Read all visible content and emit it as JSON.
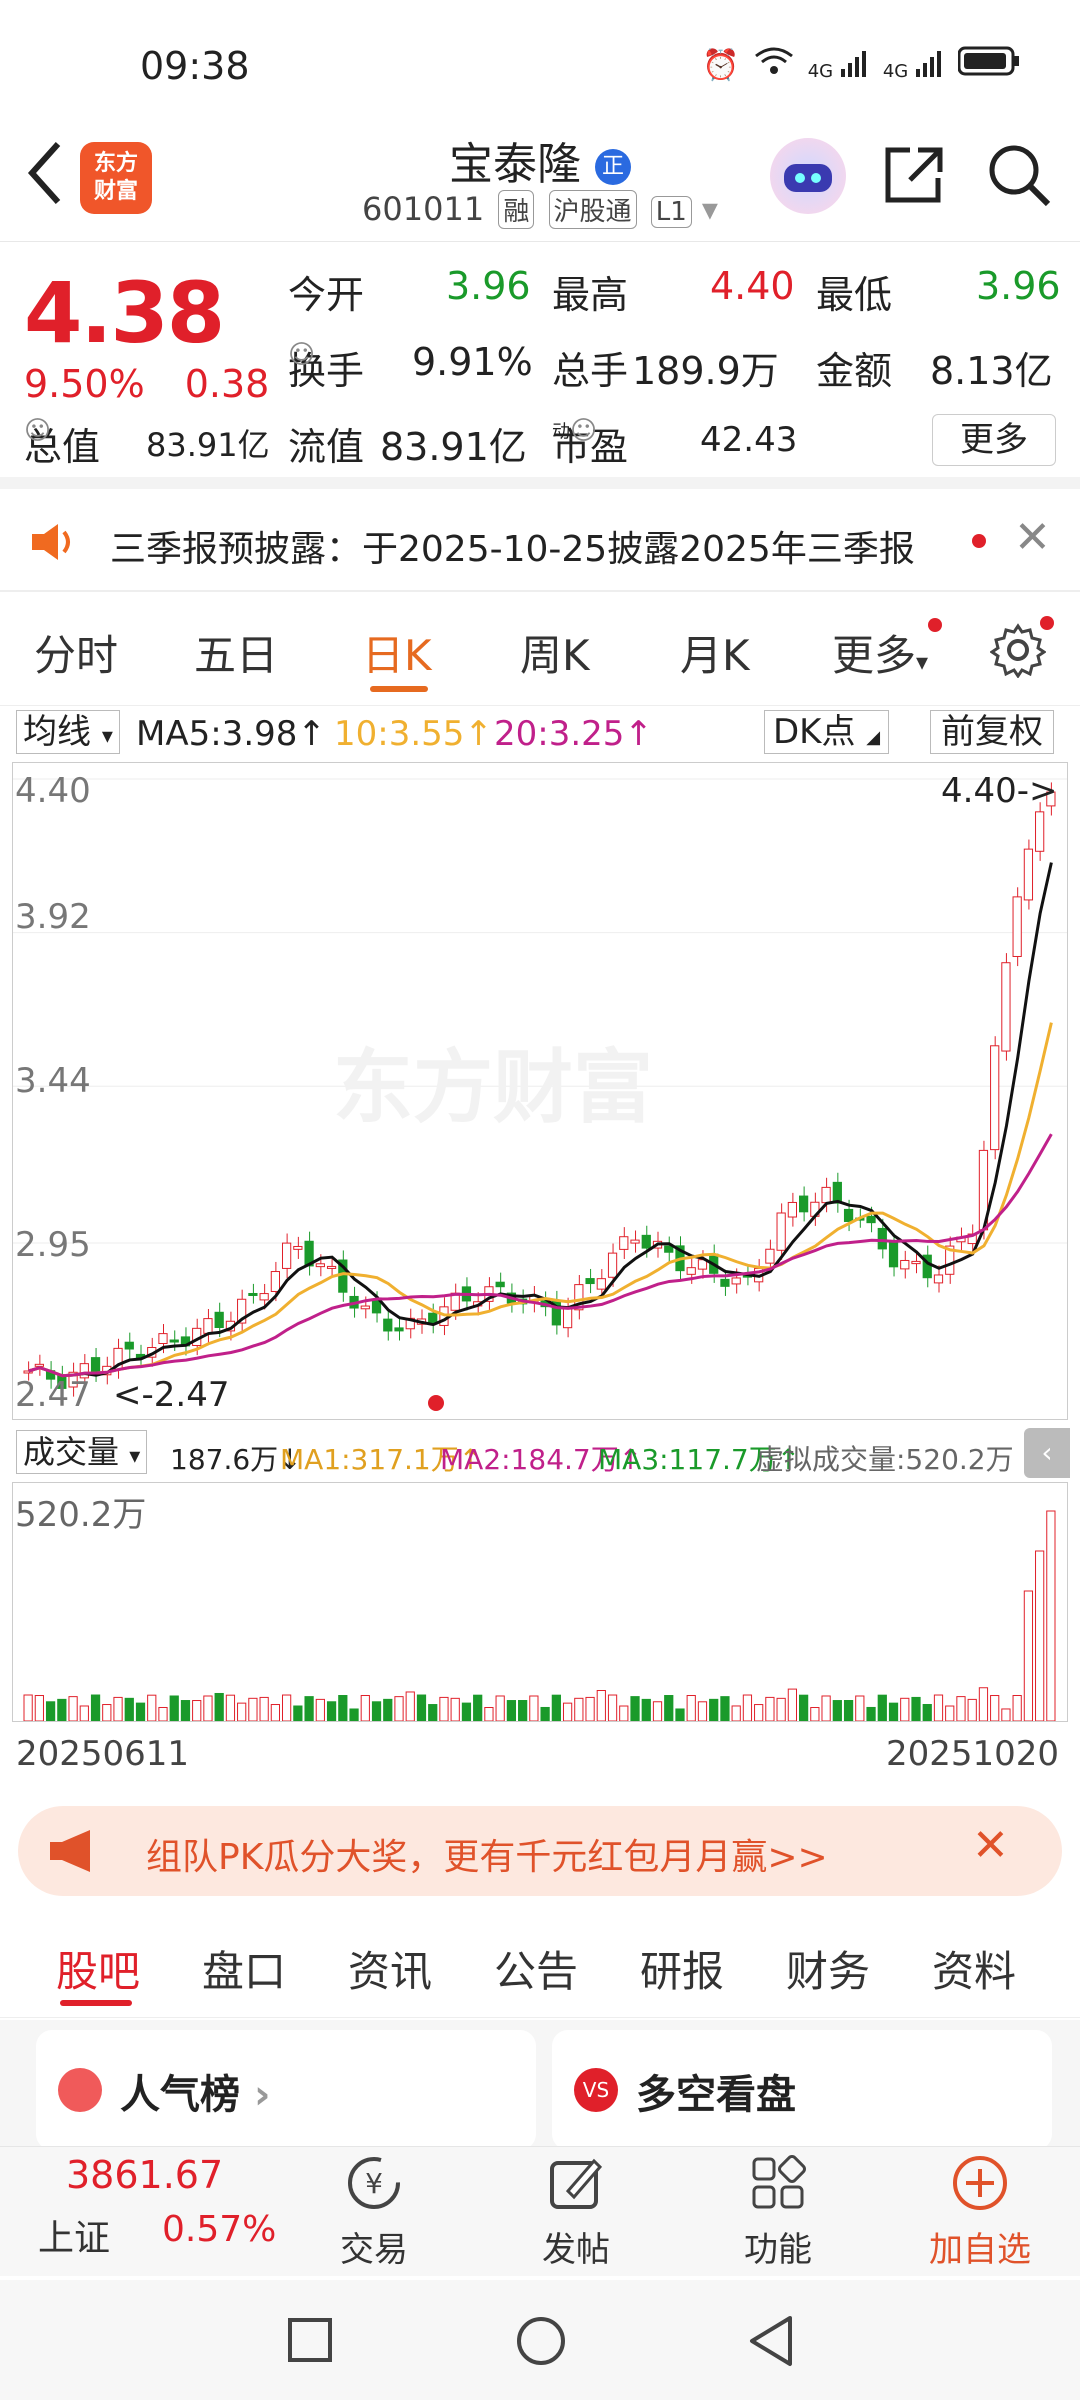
{
  "status": {
    "time": "09:38",
    "net1": "4G",
    "net2": "4G"
  },
  "header": {
    "logo_l1": "东方",
    "logo_l2": "财富",
    "title": "宝泰隆",
    "title_badge": "正",
    "code": "601011",
    "tag1": "融",
    "tag2": "沪股通",
    "tag3": "L1"
  },
  "quote": {
    "price": "4.38",
    "pct": "9.50%",
    "chg": "0.38",
    "open_label": "今开",
    "open": "3.96",
    "high_label": "最高",
    "high": "4.40",
    "low_label": "最低",
    "low": "3.96",
    "turnover_label": "换手",
    "turnover": "9.91%",
    "vol_label": "总手",
    "vol": "189.9万",
    "amount_label": "金额",
    "amount": "8.13亿",
    "mcap_label": "总值",
    "mcap": "83.91亿",
    "float_label": "流值",
    "float": "83.91亿",
    "pe_label": "市盈",
    "pe_sup": "动",
    "pe": "42.43",
    "more": "更多"
  },
  "notice": {
    "text": "三季报预披露：于2025-10-25披露2025年三季报"
  },
  "tabs": [
    "分时",
    "五日",
    "日K",
    "周K",
    "月K",
    "更多"
  ],
  "ma": {
    "type": "均线",
    "ma5": "MA5:3.98↑",
    "ma10": "10:3.55↑",
    "ma20": "20:3.25↑",
    "dk": "DK点",
    "fq": "前复权"
  },
  "chart": {
    "y_labels": [
      "4.40",
      "3.92",
      "3.44",
      "2.95",
      "2.47"
    ],
    "max_label": "4.40->",
    "min_label": "<-2.47",
    "watermark": "东方财富",
    "colors": {
      "up": "#e0202a",
      "down": "#1a9a2a",
      "ma5": "#111111",
      "ma10": "#f0b030",
      "ma20": "#c0208a"
    }
  },
  "chart_data": {
    "type": "candlestick",
    "x_start": "20250611",
    "x_end": "20251020",
    "ylim": [
      2.47,
      4.4
    ],
    "ma": {
      "MA5": 3.98,
      "MA10": 3.55,
      "MA20": 3.25
    },
    "last_close": 4.38,
    "high": 4.4,
    "low": 2.47
  },
  "volume": {
    "type": "成交量",
    "cur": "187.6万↓",
    "ma1": "MA1:317.1万↑",
    "ma2": "MA2:184.7万↑",
    "ma3": "MA3:117.7万↑",
    "virtual": "虚拟成交量:520.2万",
    "max_label": "520.2万"
  },
  "dates": {
    "start": "20250611",
    "end": "20251020"
  },
  "promo": {
    "text": "组队PK瓜分大奖，更有千元红包月月赢>>"
  },
  "sectabs": [
    "股吧",
    "盘口",
    "资讯",
    "公告",
    "研报",
    "财务",
    "资料"
  ],
  "cards": {
    "left": "人气榜",
    "right": "多空看盘"
  },
  "bottom": {
    "index_val": "3861.67",
    "index_name": "上证",
    "index_pct": "0.57%",
    "trade": "交易",
    "post": "发帖",
    "func": "功能",
    "add": "加自选"
  }
}
